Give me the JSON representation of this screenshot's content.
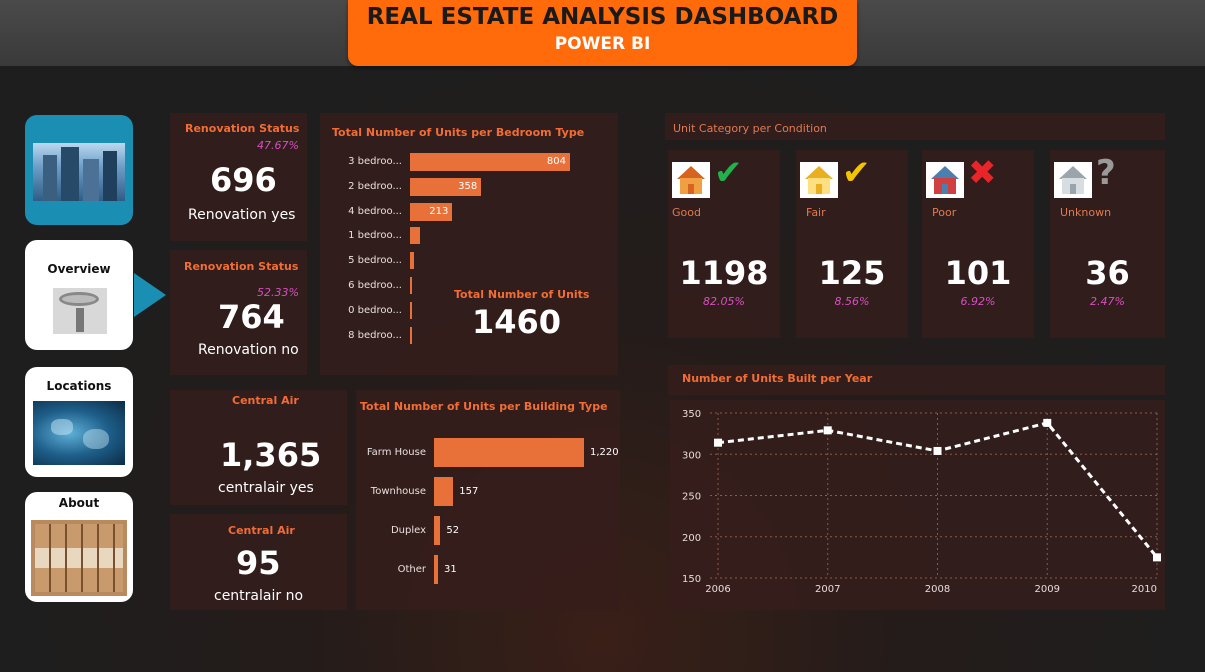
{
  "header": {
    "title": "REAL ESTATE ANALYSIS DASHBOARD",
    "subtitle": "POWER BI"
  },
  "nav": [
    {
      "label": "",
      "icon": "buildings-image"
    },
    {
      "label": "Overview",
      "icon": "overview-magnifier-image"
    },
    {
      "label": "Locations",
      "icon": "world-map-image"
    },
    {
      "label": "About",
      "icon": "about-tiles-image"
    }
  ],
  "renovation_yes": {
    "title": "Renovation Status",
    "pct": "47.67%",
    "value": "696",
    "label": "Renovation yes"
  },
  "renovation_no": {
    "title": "Renovation Status",
    "pct": "52.33%",
    "value": "764",
    "label": "Renovation no"
  },
  "central_air_yes": {
    "title": "Central Air",
    "value": "1,365",
    "label": "centralair yes"
  },
  "central_air_no": {
    "title": "Central Air",
    "value": "95",
    "label": "centralair no"
  },
  "bedroom_chart": {
    "title": "Total Number of Units per Bedroom Type",
    "total_label": "Total Number of Units",
    "total_value": "1460"
  },
  "building_chart": {
    "title": "Total Number of Units per Building Type"
  },
  "condition": {
    "title": "Unit Category per Condition",
    "items": [
      {
        "name": "Good",
        "value": "1198",
        "pct": "82.05%",
        "mark": "✔",
        "mark_color": "#22b24c",
        "icon": "house-good-icon"
      },
      {
        "name": "Fair",
        "value": "125",
        "pct": "8.56%",
        "mark": "✔",
        "mark_color": "#f5c400",
        "icon": "house-fair-icon"
      },
      {
        "name": "Poor",
        "value": "101",
        "pct": "6.92%",
        "mark": "✖",
        "mark_color": "#e8262a",
        "icon": "house-poor-icon"
      },
      {
        "name": "Unknown",
        "value": "36",
        "pct": "2.47%",
        "mark": "?",
        "mark_color": "#9a9a9a",
        "icon": "house-unknown-icon"
      }
    ]
  },
  "year_chart": {
    "title": "Number of Units Built per Year"
  },
  "chart_data": [
    {
      "type": "bar",
      "title": "Total Number of Units per Bedroom Type",
      "categories": [
        "3 bedroo...",
        "2 bedroo...",
        "4 bedroo...",
        "1 bedroo...",
        "5 bedroo...",
        "6 bedroo...",
        "0 bedroo...",
        "8 bedroo..."
      ],
      "values": [
        804,
        358,
        213,
        50,
        21,
        7,
        6,
        1
      ],
      "value_labels": [
        "804",
        "358",
        "213",
        "",
        "",
        "",
        "",
        ""
      ],
      "orientation": "horizontal"
    },
    {
      "type": "bar",
      "title": "Total Number of Units per Building Type",
      "categories": [
        "Farm House",
        "Townhouse",
        "Duplex",
        "Other"
      ],
      "values": [
        1220,
        157,
        52,
        31
      ],
      "value_labels": [
        "1,220",
        "157",
        "52",
        "31"
      ],
      "orientation": "horizontal"
    },
    {
      "type": "line",
      "title": "Number of Units Built per Year",
      "x": [
        "2006",
        "2007",
        "2008",
        "2009",
        "2010"
      ],
      "values": [
        314,
        329,
        304,
        338,
        175
      ],
      "yticks": [
        "350",
        "300",
        "250",
        "200",
        "150"
      ],
      "ylim": [
        150,
        350
      ],
      "grid": true,
      "line_color": "#ffffff",
      "line_style": "dashed"
    }
  ]
}
